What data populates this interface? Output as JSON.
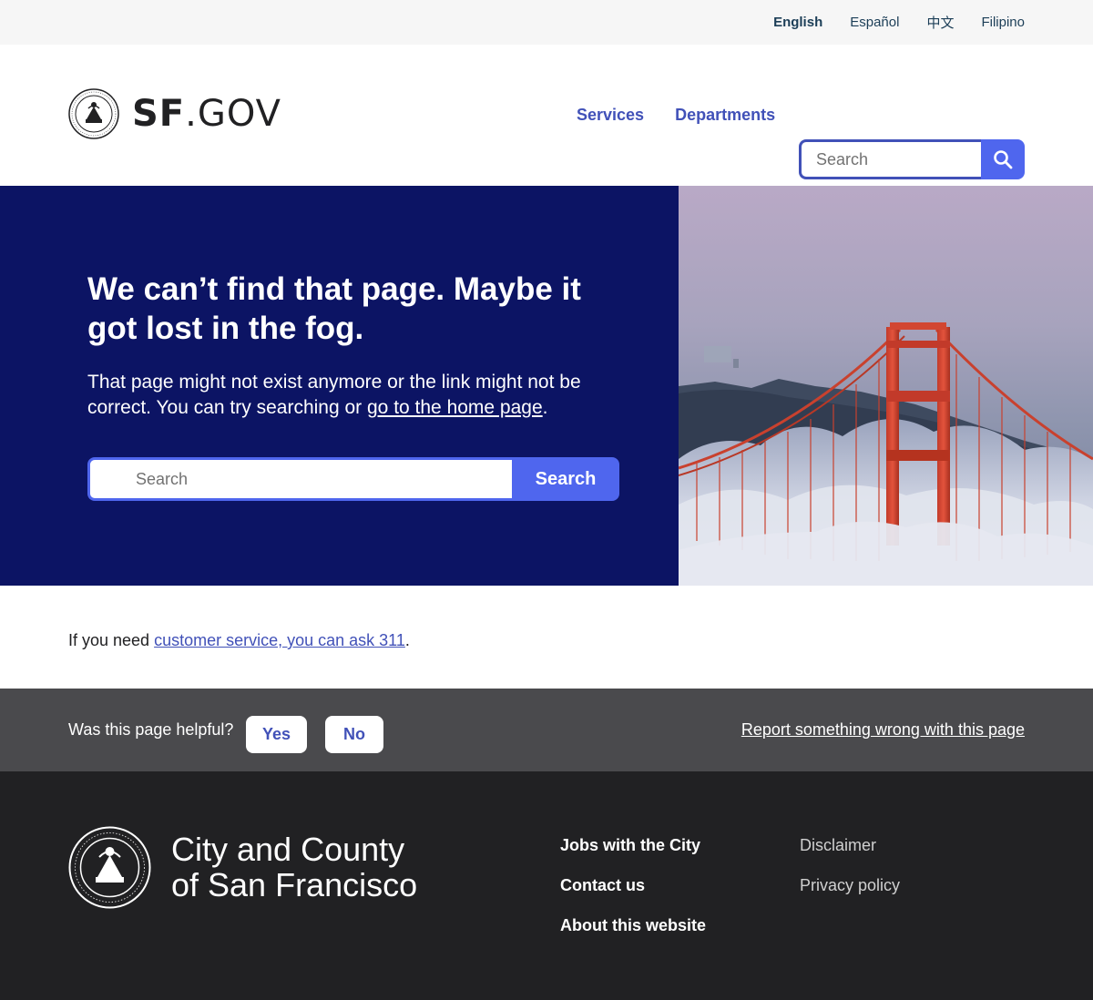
{
  "languages": [
    {
      "label": "English",
      "active": true
    },
    {
      "label": "Español",
      "active": false
    },
    {
      "label": "中文",
      "active": false
    },
    {
      "label": "Filipino",
      "active": false
    }
  ],
  "header": {
    "wordmark_bold": "SF",
    "wordmark_rest": ".GOV",
    "nav": [
      "Services",
      "Departments"
    ],
    "search_placeholder": "Search"
  },
  "hero": {
    "title": "We can’t find that page. Maybe it got lost in the fog.",
    "text_before": "That page might not exist anymore or the link might not be correct. You can try searching or ",
    "home_link": "go to the home page",
    "text_after": ".",
    "search_placeholder": "Search",
    "search_button": "Search"
  },
  "content": {
    "text_before": "If you need ",
    "link": "customer service, you can ask 311",
    "text_after": "."
  },
  "feedback": {
    "question": "Was this page helpful?",
    "yes": "Yes",
    "no": "No",
    "report": "Report something wrong with this page"
  },
  "footer": {
    "name_line1": "City and County",
    "name_line2": "of San Francisco",
    "links": [
      "Jobs with the City",
      "Contact us",
      "About this website"
    ],
    "secondary_links": [
      "Disclaimer",
      "Privacy policy"
    ]
  },
  "colors": {
    "hero_bg": "#0c1464",
    "accent": "#4f66ee",
    "link": "#4151b8",
    "feedback_bg": "#4a4a4d",
    "footer_bg": "#212123"
  }
}
